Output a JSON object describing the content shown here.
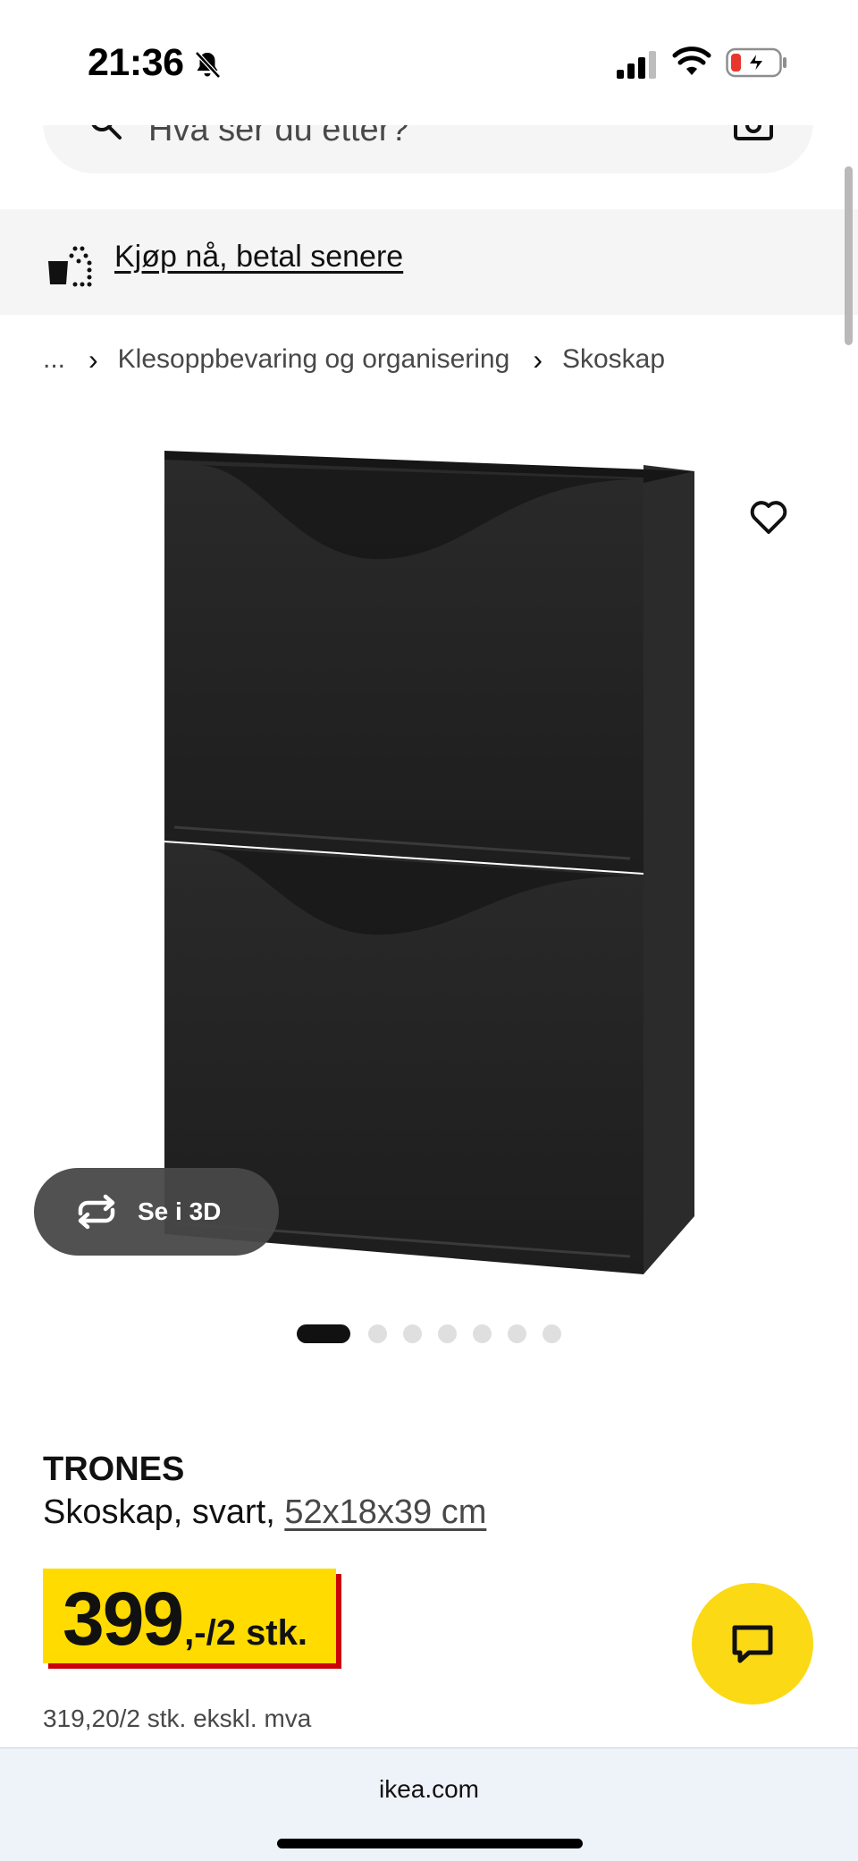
{
  "status_bar": {
    "time": "21:36",
    "icons": [
      "bell-slash-icon",
      "signal-icon",
      "wifi-icon",
      "battery-charging-icon"
    ]
  },
  "search": {
    "placeholder": "Hva ser du etter?",
    "icons": [
      "search-icon",
      "camera-icon"
    ]
  },
  "promo": {
    "label": "Kjøp nå, betal senere",
    "icon": "shopping-bag-icon"
  },
  "breadcrumb": {
    "items": [
      "...",
      "Klesoppbevaring og organisering",
      "Skoskap"
    ],
    "separator": "›"
  },
  "product": {
    "name": "TRONES",
    "description": "Skoskap, svart,",
    "dimensions": "52x18x39 cm",
    "image_count": 7,
    "active_image": 1,
    "see_3d_label": "Se i 3D",
    "price_main": "399",
    "price_suffix": ",-/2 stk.",
    "price_excl_vat": "319,20/2 stk. ekskl. mva"
  },
  "browser": {
    "url": "ikea.com"
  },
  "colors": {
    "price_yellow": "#ffdb00",
    "price_red": "#cc0008",
    "chat_yellow": "#fbd914",
    "button_dark": "#484848"
  }
}
